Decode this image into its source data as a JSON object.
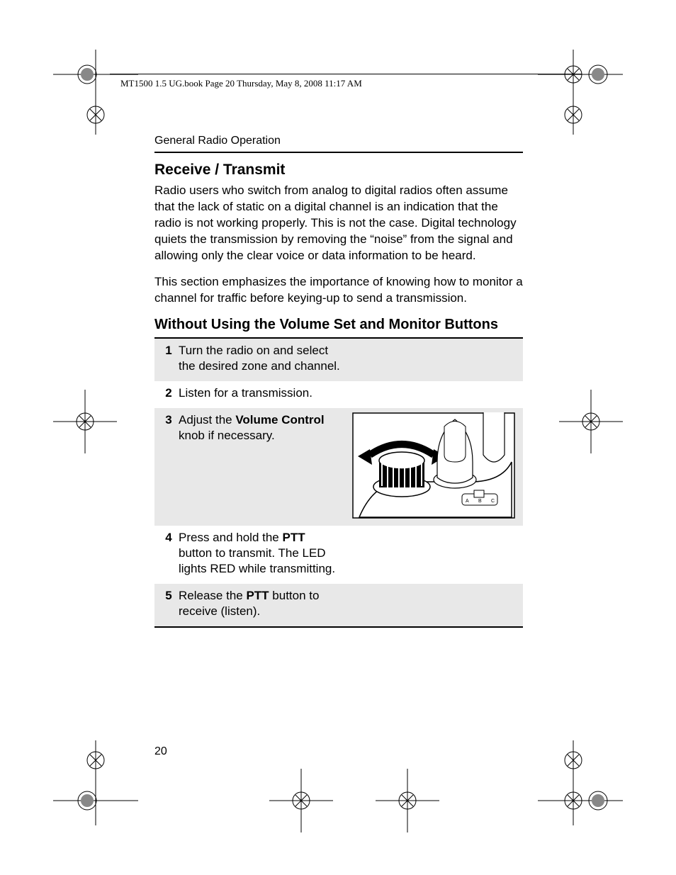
{
  "header": {
    "crop_text": "MT1500 1.5 UG.book  Page 20  Thursday, May 8, 2008  11:17 AM"
  },
  "section_label": "General Radio Operation",
  "h2": "Receive / Transmit",
  "para1": "Radio users who switch from analog to digital radios often assume that the lack of static on a digital channel is an indication that the radio is not working properly. This is not the case. Digital technology quiets the transmission by removing the “noise” from the signal and allowing only the clear voice or data information to be heard.",
  "para2": "This section emphasizes the importance of knowing how to monitor a channel for traffic before keying-up to send a transmission.",
  "h3": "Without Using the Volume Set and Monitor Buttons",
  "steps": [
    {
      "num": "1",
      "text": "Turn the radio on and select the desired zone and channel."
    },
    {
      "num": "2",
      "text": "Listen for a transmission."
    },
    {
      "num": "3",
      "pre": "Adjust the ",
      "bold": "Volume Control",
      "post": " knob if necessary."
    },
    {
      "num": "4",
      "pre": "Press and hold the ",
      "bold": "PTT",
      "post": " button to transmit. The LED lights RED while transmitting."
    },
    {
      "num": "5",
      "pre": "Release the ",
      "bold": "PTT",
      "post": " button to receive (listen)."
    }
  ],
  "page_number": "20"
}
